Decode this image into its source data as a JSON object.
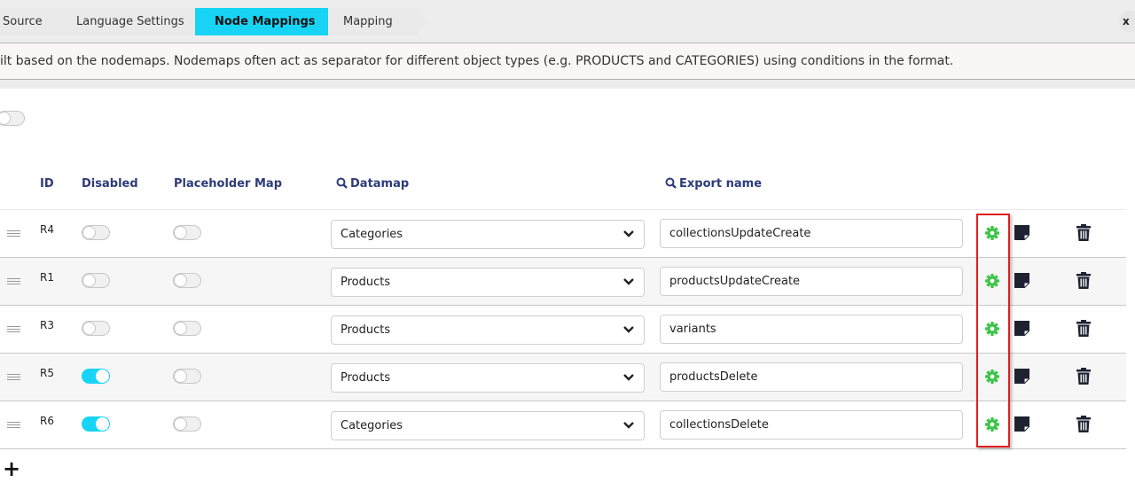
{
  "steps": [
    {
      "label": "Source",
      "active": false
    },
    {
      "label": "Language Settings",
      "active": false
    },
    {
      "label": "Node Mappings",
      "active": true
    },
    {
      "label": "Mapping",
      "active": false
    }
  ],
  "close_label": "x",
  "info_text": "ilt based on the nodemaps. Nodemaps often act as separator for different object types (e.g. PRODUCTS and CATEGORIES) using conditions in the format.",
  "top_toggle": {
    "on": false
  },
  "table": {
    "headers": {
      "id": "ID",
      "disabled": "Disabled",
      "placeholder_map": "Placeholder Map",
      "datamap": "Datamap",
      "export_name": "Export name"
    },
    "rows": [
      {
        "id": "R4",
        "disabled": false,
        "placeholder_map": false,
        "datamap": "Categories",
        "export_name": "collectionsUpdateCreate"
      },
      {
        "id": "R1",
        "disabled": false,
        "placeholder_map": false,
        "datamap": "Products",
        "export_name": "productsUpdateCreate"
      },
      {
        "id": "R3",
        "disabled": false,
        "placeholder_map": false,
        "datamap": "Products",
        "export_name": "variants"
      },
      {
        "id": "R5",
        "disabled": true,
        "placeholder_map": false,
        "datamap": "Products",
        "export_name": "productsDelete"
      },
      {
        "id": "R6",
        "disabled": true,
        "placeholder_map": false,
        "datamap": "Categories",
        "export_name": "collectionsDelete"
      }
    ]
  },
  "add_label": "+",
  "colors": {
    "accent": "#17d4f5",
    "header_text": "#2e3b7a",
    "gear": "#3ec44a",
    "highlight": "#e01c1c"
  }
}
